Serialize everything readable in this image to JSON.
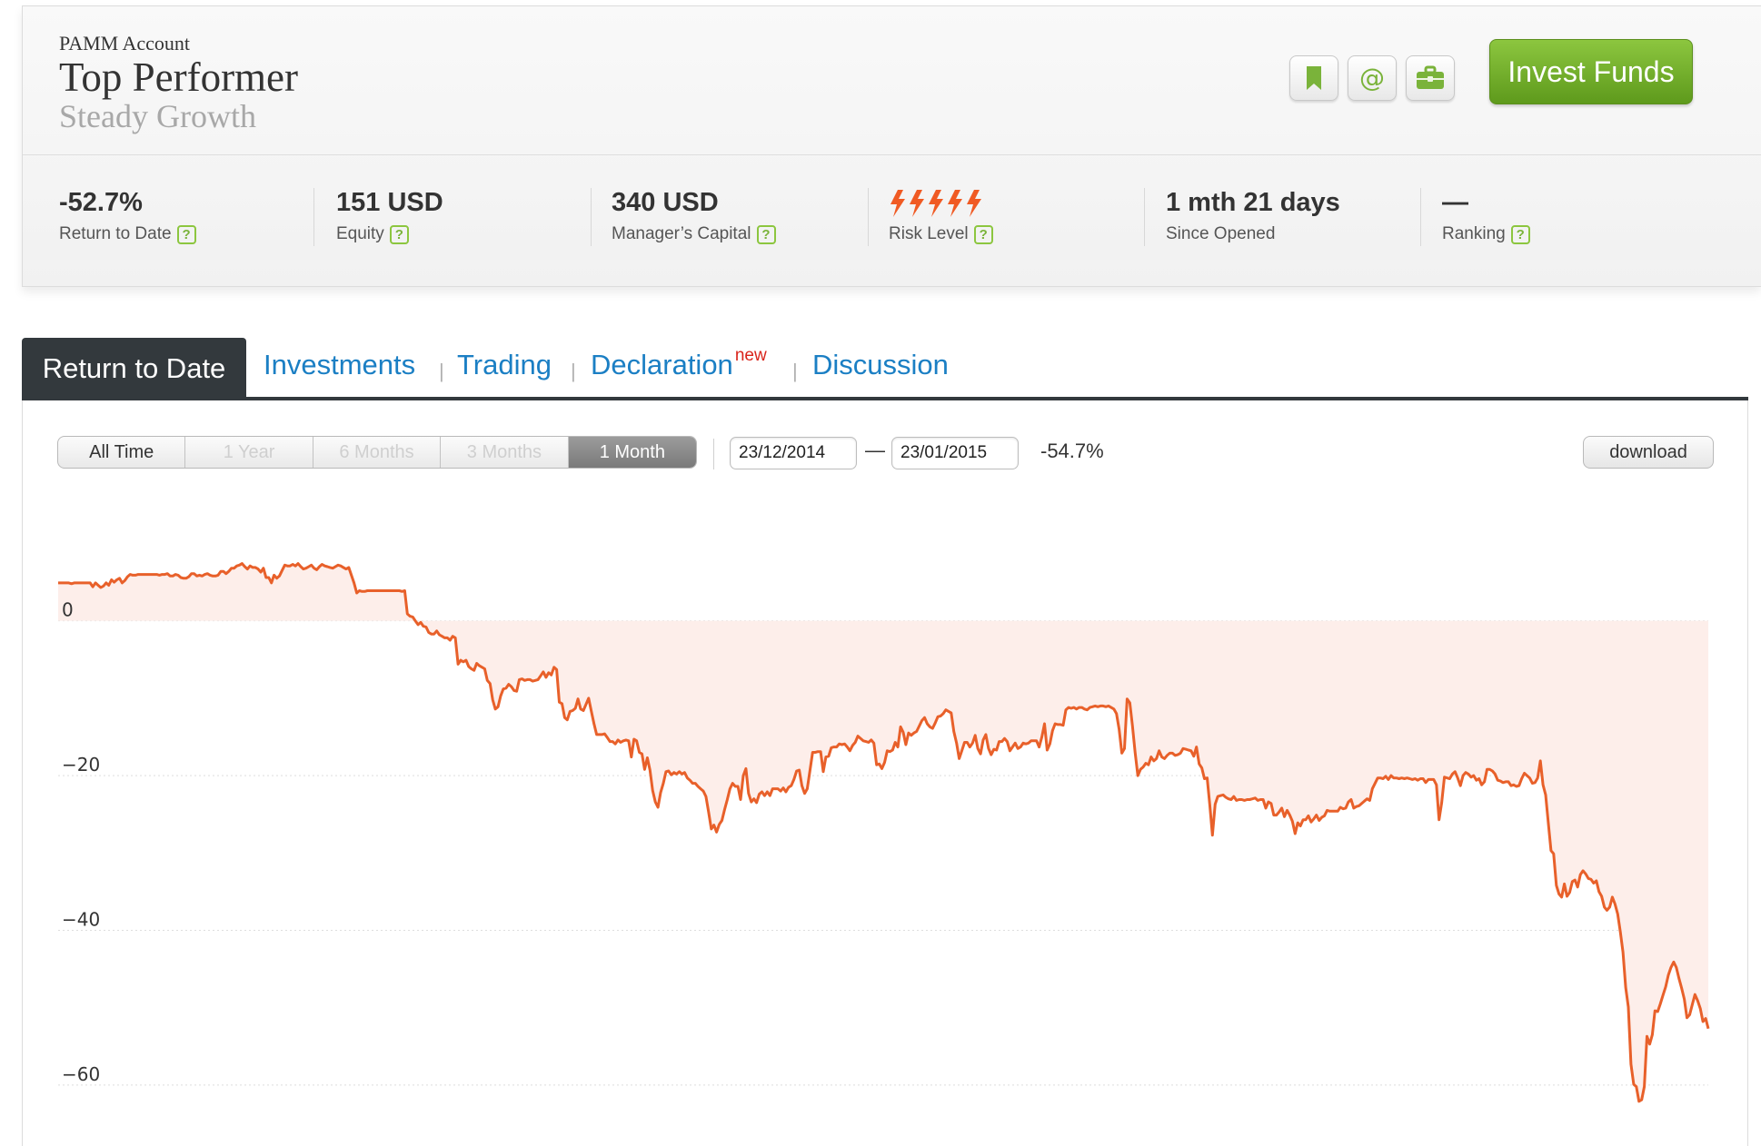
{
  "header": {
    "account_type": "PAMM Account",
    "account_name": "Top Performer",
    "strategy": "Steady Growth",
    "invest_button": "Invest Funds",
    "icons": [
      "bookmark-icon",
      "email-icon",
      "briefcase-icon"
    ],
    "colors": {
      "invest": "#6aa829",
      "icon_green": "#7ab33a",
      "risk": "#f05a23"
    }
  },
  "stats": [
    {
      "value": "-52.7%",
      "label": "Return to Date",
      "help": "?"
    },
    {
      "value": "151 USD",
      "label": "Equity",
      "help": "?"
    },
    {
      "value": "340 USD",
      "label": "Manager’s Capital",
      "help": "?"
    },
    {
      "value": "ϟϟϟϟϟ",
      "label": "Risk Level",
      "help": "?",
      "risk_level": 5
    },
    {
      "value": "1 mth 21 days",
      "label": "Since Opened"
    },
    {
      "value": "—",
      "label": "Ranking",
      "help": "?"
    }
  ],
  "tabs": {
    "active": "Return to Date",
    "items": [
      "Investments",
      "Trading",
      "Declaration",
      "Discussion"
    ],
    "new_badge": "new",
    "separator": "|"
  },
  "controls": {
    "ranges": [
      "All Time",
      "1 Year",
      "6 Months",
      "3 Months",
      "1 Month"
    ],
    "enabled": [
      true,
      false,
      false,
      false,
      true
    ],
    "selected": "1 Month",
    "date_from": "23/12/2014",
    "date_to": "23/01/2015",
    "date_separator": "—",
    "period_return": "-54.7%",
    "download": "download"
  },
  "chart_data": {
    "type": "area",
    "series": [
      {
        "values": [
          4.9,
          4.9,
          4.9,
          4.9,
          4.9,
          4.8,
          4.9,
          4.9,
          4.9,
          4.9,
          4.9,
          4.9,
          4.9,
          4.4,
          4.9,
          4.6,
          4.3,
          4.5,
          4.9,
          4.6,
          5.3,
          5.0,
          5.3,
          5.5,
          4.9,
          5.2,
          5.7,
          6.0,
          5.9,
          5.9,
          6.0,
          6.0,
          6.0,
          6.0,
          6.0,
          6.0,
          6.0,
          6.0,
          5.9,
          6.0,
          6.0,
          6.1,
          5.8,
          5.8,
          6.0,
          5.9,
          5.6,
          5.5,
          5.5,
          5.7,
          6.1,
          6.1,
          5.8,
          5.9,
          5.8,
          6.0,
          6.1,
          5.9,
          5.8,
          5.8,
          5.9,
          6.4,
          6.4,
          6.1,
          6.4,
          6.8,
          6.8,
          7.1,
          7.2,
          7.4,
          7.0,
          6.7,
          7.1,
          6.9,
          6.9,
          6.7,
          6.3,
          6.8,
          5.6,
          5.6,
          4.9,
          5.9,
          5.5,
          5.8,
          6.5,
          7.2,
          7.1,
          7.1,
          7.3,
          7.1,
          7.4,
          7.0,
          6.7,
          6.8,
          7.0,
          7.2,
          6.8,
          6.6,
          7.0,
          7.3,
          7.1,
          7.0,
          6.9,
          6.8,
          7.0,
          7.2,
          7.1,
          6.9,
          6.7,
          6.9,
          5.9,
          4.9,
          3.6,
          3.9,
          3.8,
          3.8,
          3.9,
          3.9,
          3.9,
          3.9,
          3.9,
          3.9,
          3.9,
          3.9,
          3.9,
          3.9,
          3.9,
          3.9,
          3.9,
          3.8,
          3.9,
          0.9,
          0.6,
          0.5,
          0.0,
          -0.5,
          -0.2,
          -0.7,
          -0.8,
          -1.5,
          -1.7,
          -1.7,
          -1.3,
          -1.8,
          -2.0,
          -2.2,
          -2.2,
          -2.5,
          -2.0,
          -2.2,
          -5.6,
          -5.1,
          -5.3,
          -5.1,
          -5.9,
          -6.2,
          -6.4,
          -5.5,
          -5.8,
          -6.0,
          -6.2,
          -7.7,
          -8.1,
          -10.2,
          -11.4,
          -11.1,
          -9.7,
          -8.8,
          -8.7,
          -8.2,
          -8.5,
          -9.0,
          -9.1,
          -7.6,
          -7.5,
          -7.7,
          -7.6,
          -7.6,
          -7.8,
          -7.7,
          -7.6,
          -7.1,
          -6.6,
          -7.3,
          -6.7,
          -7.0,
          -6.0,
          -6.3,
          -10.5,
          -10.7,
          -12.5,
          -12.8,
          -11.7,
          -11.6,
          -11.3,
          -10.1,
          -11.4,
          -11.6,
          -10.8,
          -10.0,
          -11.7,
          -13.3,
          -14.7,
          -14.7,
          -14.7,
          -14.6,
          -15.1,
          -15.6,
          -15.6,
          -15.9,
          -15.4,
          -15.7,
          -15.5,
          -15.4,
          -15.5,
          -17.6,
          -15.3,
          -15.5,
          -17.0,
          -17.2,
          -19.2,
          -17.7,
          -19.3,
          -21.9,
          -23.4,
          -24.1,
          -22.2,
          -21.0,
          -19.5,
          -19.4,
          -19.9,
          -19.6,
          -19.8,
          -19.5,
          -19.8,
          -19.6,
          -20.3,
          -20.6,
          -21.0,
          -21.0,
          -21.4,
          -21.7,
          -22.0,
          -22.7,
          -24.7,
          -26.9,
          -26.4,
          -27.3,
          -26.3,
          -25.8,
          -24.4,
          -23.1,
          -21.7,
          -21.0,
          -21.4,
          -21.4,
          -23.1,
          -20.0,
          -19.1,
          -22.3,
          -23.4,
          -23.0,
          -23.5,
          -22.4,
          -22.1,
          -22.6,
          -22.1,
          -22.6,
          -21.7,
          -21.7,
          -21.7,
          -22.0,
          -21.6,
          -22.1,
          -21.5,
          -21.3,
          -20.5,
          -19.4,
          -19.3,
          -21.3,
          -22.3,
          -21.7,
          -19.4,
          -17.0,
          -17.0,
          -16.9,
          -16.9,
          -19.5,
          -17.6,
          -17.5,
          -16.4,
          -16.3,
          -16.3,
          -15.9,
          -16.0,
          -15.9,
          -16.3,
          -16.8,
          -16.1,
          -15.7,
          -14.9,
          -15.2,
          -15.5,
          -15.6,
          -15.7,
          -15.4,
          -15.8,
          -18.6,
          -18.5,
          -19.1,
          -18.3,
          -16.8,
          -16.9,
          -16.7,
          -15.7,
          -16.3,
          -13.7,
          -14.4,
          -16.0,
          -14.5,
          -14.8,
          -14.5,
          -14.3,
          -13.6,
          -12.9,
          -12.5,
          -13.3,
          -13.7,
          -13.9,
          -13.2,
          -12.4,
          -12.3,
          -12.0,
          -11.5,
          -11.7,
          -11.9,
          -14.3,
          -15.8,
          -17.8,
          -16.8,
          -15.7,
          -15.7,
          -16.3,
          -15.8,
          -14.8,
          -16.5,
          -17.2,
          -15.4,
          -14.7,
          -16.5,
          -17.3,
          -16.6,
          -16.7,
          -15.6,
          -15.6,
          -15.2,
          -15.6,
          -16.8,
          -16.3,
          -15.8,
          -16.5,
          -16.3,
          -15.8,
          -15.9,
          -15.8,
          -15.5,
          -15.5,
          -15.5,
          -16.3,
          -15.0,
          -13.3,
          -16.7,
          -15.9,
          -14.2,
          -13.3,
          -13.4,
          -13.4,
          -13.5,
          -11.5,
          -11.2,
          -11.3,
          -11.2,
          -11.4,
          -11.2,
          -11.2,
          -11.4,
          -11.5,
          -11.2,
          -11.1,
          -11.0,
          -11.1,
          -11.0,
          -11.0,
          -11.1,
          -11.0,
          -11.2,
          -11.4,
          -12.0,
          -14.0,
          -17.1,
          -16.5,
          -10.1,
          -10.6,
          -13.6,
          -17.0,
          -20.0,
          -19.2,
          -18.9,
          -18.4,
          -18.6,
          -17.6,
          -18.1,
          -17.8,
          -16.8,
          -17.6,
          -17.8,
          -17.4,
          -17.1,
          -17.1,
          -17.4,
          -17.3,
          -17.1,
          -16.5,
          -16.6,
          -16.7,
          -16.8,
          -17.5,
          -16.3,
          -18.5,
          -19.0,
          -20.4,
          -20.3,
          -23.8,
          -27.7,
          -23.7,
          -22.7,
          -22.6,
          -22.5,
          -22.8,
          -23.0,
          -23.1,
          -22.7,
          -23.2,
          -23.1,
          -23.1,
          -23.2,
          -23.1,
          -23.1,
          -23.0,
          -22.9,
          -23.2,
          -23.1,
          -23.1,
          -24.2,
          -23.4,
          -23.6,
          -25.1,
          -25.1,
          -24.7,
          -24.2,
          -25.3,
          -24.5,
          -25.1,
          -25.9,
          -27.5,
          -26.1,
          -26.5,
          -25.7,
          -25.7,
          -25.2,
          -26.0,
          -25.6,
          -25.1,
          -25.8,
          -25.4,
          -25.2,
          -24.5,
          -24.6,
          -24.6,
          -24.6,
          -24.6,
          -24.1,
          -24.3,
          -24.2,
          -23.4,
          -23.1,
          -24.2,
          -24.0,
          -23.9,
          -23.6,
          -23.3,
          -23.0,
          -23.2,
          -21.7,
          -21.0,
          -20.3,
          -20.3,
          -20.4,
          -20.1,
          -20.5,
          -20.0,
          -20.3,
          -20.3,
          -20.4,
          -20.3,
          -20.4,
          -20.3,
          -20.4,
          -20.5,
          -20.4,
          -20.6,
          -20.4,
          -20.4,
          -20.9,
          -20.5,
          -20.5,
          -20.5,
          -21.2,
          -25.7,
          -23.5,
          -20.2,
          -20.3,
          -20.4,
          -19.8,
          -19.5,
          -20.3,
          -21.3,
          -20.0,
          -19.6,
          -19.8,
          -20.2,
          -20.0,
          -20.6,
          -20.4,
          -21.2,
          -20.8,
          -19.2,
          -19.2,
          -19.4,
          -19.8,
          -20.6,
          -20.7,
          -20.9,
          -20.8,
          -20.8,
          -21.3,
          -21.2,
          -21.4,
          -21.3,
          -20.4,
          -19.7,
          -20.0,
          -20.3,
          -21.0,
          -20.9,
          -20.3,
          -18.1,
          -21.2,
          -22.5,
          -26.2,
          -29.7,
          -30.1,
          -34.2,
          -35.3,
          -35.7,
          -34.0,
          -35.6,
          -35.1,
          -33.7,
          -33.5,
          -34.4,
          -32.8,
          -32.3,
          -32.7,
          -33.3,
          -33.4,
          -33.9,
          -33.6,
          -35.0,
          -35.6,
          -37.0,
          -37.4,
          -37.0,
          -35.7,
          -36.6,
          -37.9,
          -40.2,
          -42.8,
          -47.4,
          -49.9,
          -57.3,
          -59.9,
          -60.2,
          -62.1,
          -61.9,
          -60.2,
          -53.7,
          -54.7,
          -53.5,
          -50.4,
          -50.5,
          -49.5,
          -48.4,
          -47.3,
          -45.8,
          -44.8,
          -44.1,
          -44.8,
          -46.2,
          -47.5,
          -48.9,
          -51.3,
          -50.9,
          -49.6,
          -48.3,
          -49.1,
          -50.1,
          -51.8,
          -51.4,
          -52.7
        ]
      }
    ],
    "baseline": 0,
    "yticks": [
      0,
      -20,
      -40,
      -60
    ],
    "ylim": [
      -64,
      9
    ],
    "grid": true,
    "colors": {
      "line": "#e8602a",
      "fill": "#fdeeea",
      "grid": "#dedede"
    }
  }
}
